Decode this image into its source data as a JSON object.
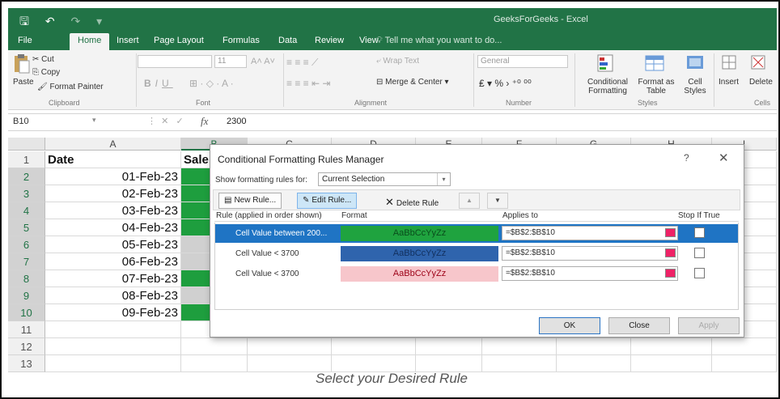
{
  "window": {
    "title": "GeeksForGeeks - Excel",
    "qat": {
      "save_icon": "🖫",
      "undo_icon": "↶",
      "redo_icon": "↷",
      "customize_icon": "▾"
    }
  },
  "tabs": [
    "File",
    "Home",
    "Insert",
    "Page Layout",
    "Formulas",
    "Data",
    "Review",
    "View"
  ],
  "active_tab": "Home",
  "tell_me": "Tell me what you want to do...",
  "ribbon": {
    "clipboard": {
      "paste": "Paste",
      "cut": "Cut",
      "copy": "Copy",
      "format_painter": "Format Painter",
      "label": "Clipboard"
    },
    "font": {
      "font_size": "11",
      "label": "Font"
    },
    "alignment": {
      "wrap_text": "Wrap Text",
      "merge_center": "Merge & Center",
      "label": "Alignment"
    },
    "number": {
      "format": "General",
      "label": "Number"
    },
    "styles": {
      "conditional_formatting": "Conditional Formatting",
      "format_as_table": "Format as Table",
      "cell_styles": "Cell Styles",
      "label": "Styles"
    },
    "cells": {
      "insert": "Insert",
      "delete": "Delete",
      "label": "Cells"
    }
  },
  "formula_bar": {
    "name_box": "B10",
    "fx": "fx",
    "value": "2300"
  },
  "columns": [
    "A",
    "B",
    "C",
    "D",
    "E",
    "F",
    "G",
    "H",
    "I"
  ],
  "rows": [
    "1",
    "2",
    "3",
    "4",
    "5",
    "6",
    "7",
    "8",
    "9",
    "10",
    "11",
    "12",
    "13"
  ],
  "sheet": {
    "header_a": "Date",
    "header_b": "Sale",
    "dates": [
      "01-Feb-23",
      "02-Feb-23",
      "03-Feb-23",
      "04-Feb-23",
      "05-Feb-23",
      "06-Feb-23",
      "07-Feb-23",
      "08-Feb-23",
      "09-Feb-23"
    ],
    "b_fills": [
      "#1e9e3e",
      "#1e9e3e",
      "#1e9e3e",
      "#1e9e3e",
      "#d0d0d0",
      "#d0d0d0",
      "#1e9e3e",
      "#d0d0d0",
      "#1e9e3e"
    ]
  },
  "dialog": {
    "title": "Conditional Formatting Rules Manager",
    "help": "?",
    "close": "✕",
    "show_rules_label": "Show formatting rules for:",
    "show_rules_value": "Current Selection",
    "new_rule": "New Rule...",
    "edit_rule": "Edit Rule...",
    "delete_rule": "Delete Rule",
    "col_rule": "Rule (applied in order shown)",
    "col_format": "Format",
    "col_applies": "Applies to",
    "col_stop": "Stop If True",
    "rules": [
      {
        "name": "Cell Value between 200...",
        "preview": "AaBbCcYyZz",
        "preview_bg": "#1fa33f",
        "preview_fg": "#0a4d1c",
        "applies_to": "=$B$2:$B$10",
        "selected": true
      },
      {
        "name": "Cell Value < 3700",
        "preview": "AaBbCcYyZz",
        "preview_bg": "#2f64ad",
        "preview_fg": "#12305e",
        "applies_to": "=$B$2:$B$10",
        "selected": false
      },
      {
        "name": "Cell Value < 3700",
        "preview": "AaBbCcYyZz",
        "preview_bg": "#f7c6cb",
        "preview_fg": "#9c0016",
        "applies_to": "=$B$2:$B$10",
        "selected": false
      }
    ],
    "ok": "OK",
    "close_btn": "Close",
    "apply": "Apply"
  },
  "caption": "Select your Desired Rule"
}
